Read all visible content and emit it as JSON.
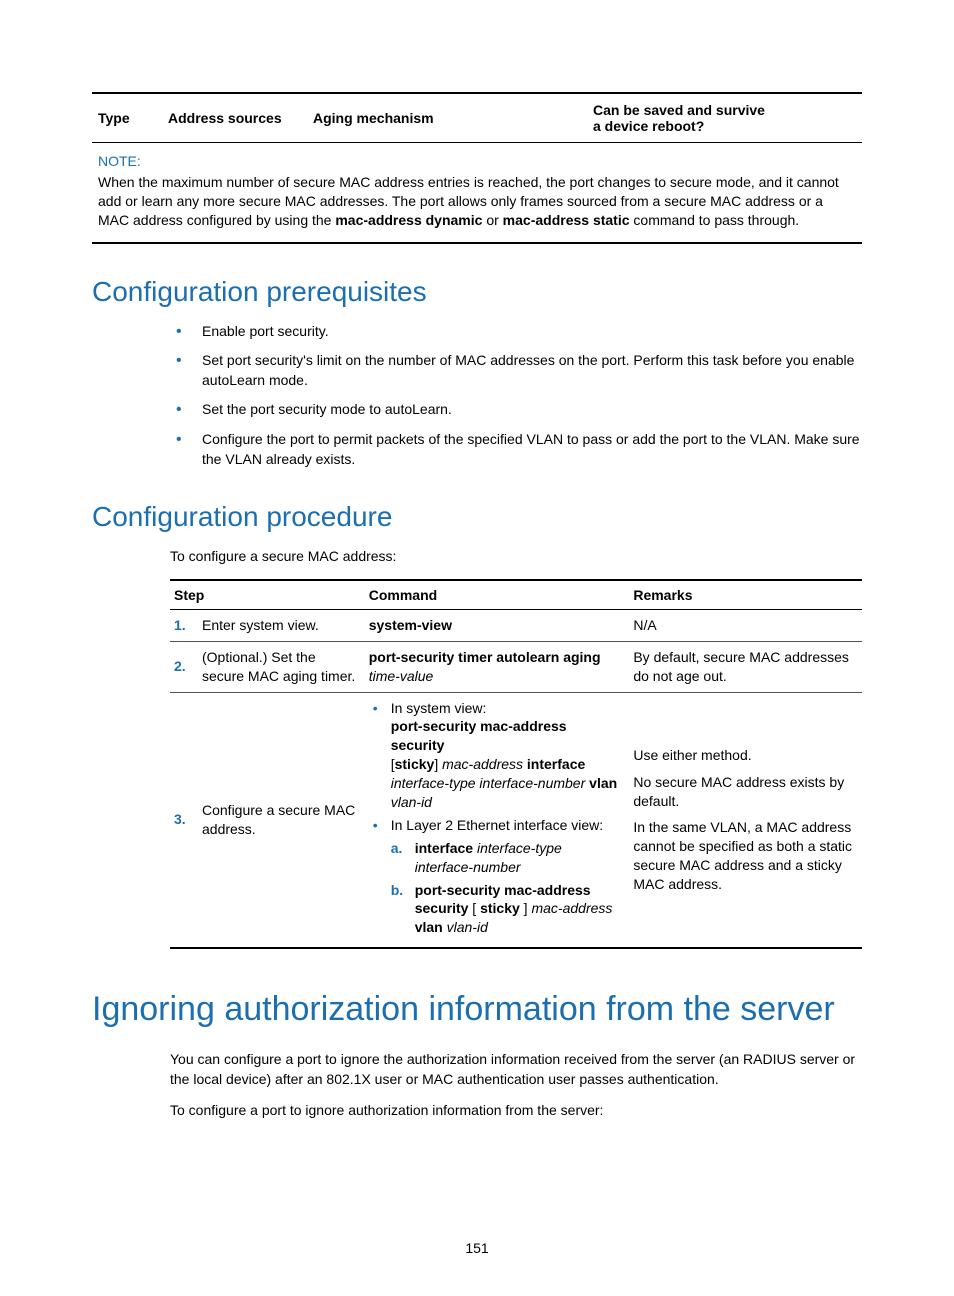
{
  "top_table": {
    "headers": {
      "type": "Type",
      "sources": "Address sources",
      "aging": "Aging mechanism",
      "save": "Can be saved and survive a device reboot?"
    },
    "note_label": "NOTE:",
    "note_text_1": "When the maximum number of secure MAC address entries is reached, the port changes to secure mode, and it cannot add or learn any more secure MAC addresses. The port allows only frames sourced from a secure MAC address or a MAC address configured by using the ",
    "note_bold_1": "mac-address dynamic",
    "note_text_2": " or ",
    "note_bold_2": "mac-address static",
    "note_text_3": " command to pass through."
  },
  "prereq": {
    "heading": "Configuration prerequisites",
    "items": [
      "Enable port security.",
      "Set port security's limit on the number of MAC addresses on the port. Perform this task before you enable autoLearn mode.",
      "Set the port security mode to autoLearn.",
      "Configure the port to permit packets of the specified VLAN to pass or add the port to the VLAN. Make sure the VLAN already exists."
    ]
  },
  "proc": {
    "heading": "Configuration procedure",
    "intro": "To configure a secure MAC address:",
    "headers": {
      "step": "Step",
      "command": "Command",
      "remarks": "Remarks"
    },
    "row1": {
      "num": "1.",
      "step": "Enter system view.",
      "cmd": "system-view",
      "rem": "N/A"
    },
    "row2": {
      "num": "2.",
      "step": "(Optional.) Set the secure MAC aging timer.",
      "cmd_bold": "port-security timer autolearn aging",
      "cmd_italic": "time-value",
      "rem": "By default, secure MAC addresses do not age out."
    },
    "row3": {
      "num": "3.",
      "step": "Configure a secure MAC address.",
      "b1_line1": "In system view:",
      "b1_l2a": "port-security mac-address security",
      "b1_l3a": "[",
      "b1_l3b": "sticky",
      "b1_l3c": "] ",
      "b1_l3d": "mac-address",
      "b1_l3e": " interface",
      "b1_l4a": "interface-type interface-number",
      "b1_l4b": " vlan",
      "b1_l5": "vlan-id",
      "b2_line1": "In Layer 2 Ethernet interface view:",
      "sub_a_mark": "a.",
      "sub_a_bold": "interface",
      "sub_a_italic": " interface-type interface-number",
      "sub_b_mark": "b.",
      "sub_b_l1": "port-security mac-address security",
      "sub_b_l2a": " [ ",
      "sub_b_l2b": "sticky",
      "sub_b_l2c": " ] ",
      "sub_b_l2d": "mac-address",
      "sub_b_l3a": "vlan",
      "sub_b_l3b": " vlan-id",
      "rem_p1": "Use either method.",
      "rem_p2": "No secure MAC address exists by default.",
      "rem_p3": "In the same VLAN, a MAC address cannot be specified as both a static secure MAC address and a sticky MAC address."
    }
  },
  "ignore": {
    "heading": "Ignoring authorization information from the server",
    "p1": "You can configure a port to ignore the authorization information received from the server (an RADIUS server or the local device) after an 802.1X user or MAC authentication user passes authentication.",
    "p2": "To configure a port to ignore authorization information from the server:"
  },
  "page_number": "151"
}
